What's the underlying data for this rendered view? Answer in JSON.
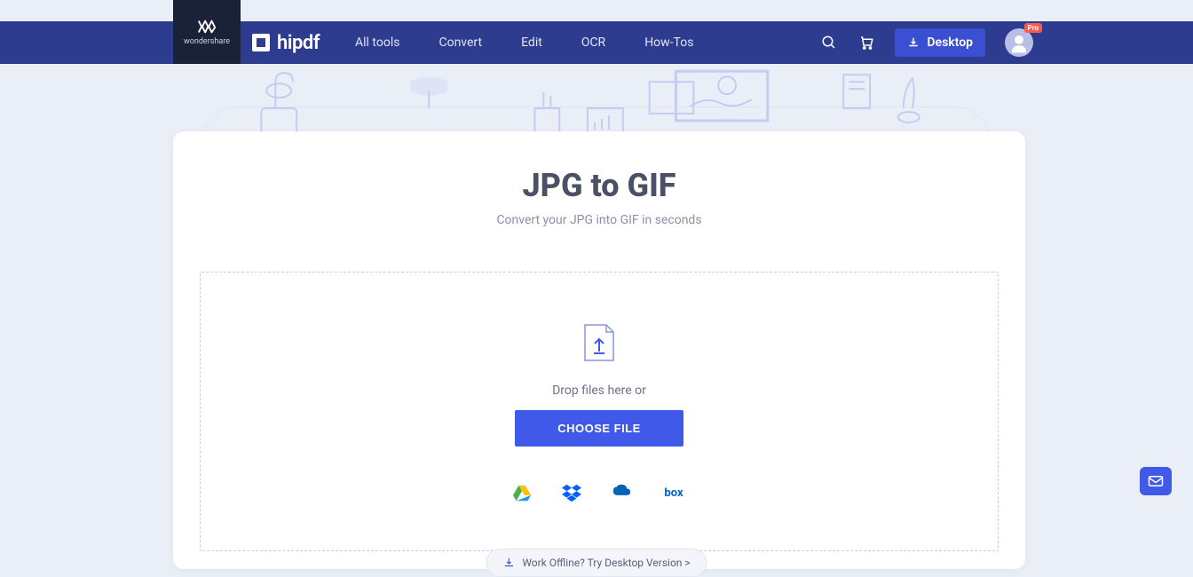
{
  "brand": {
    "wondershare": "wondershare",
    "name": "hipdf"
  },
  "nav": {
    "links": [
      "All tools",
      "Convert",
      "Edit",
      "OCR",
      "How-Tos"
    ],
    "desktop": "Desktop",
    "pro": "Pro"
  },
  "page": {
    "title": "JPG to GIF",
    "subtitle": "Convert your JPG into GIF in seconds",
    "drop_text": "Drop files here or",
    "choose_file": "CHOOSE FILE",
    "offline": "Work Offline? Try Desktop Version >"
  },
  "cloud": {
    "box": "box"
  }
}
